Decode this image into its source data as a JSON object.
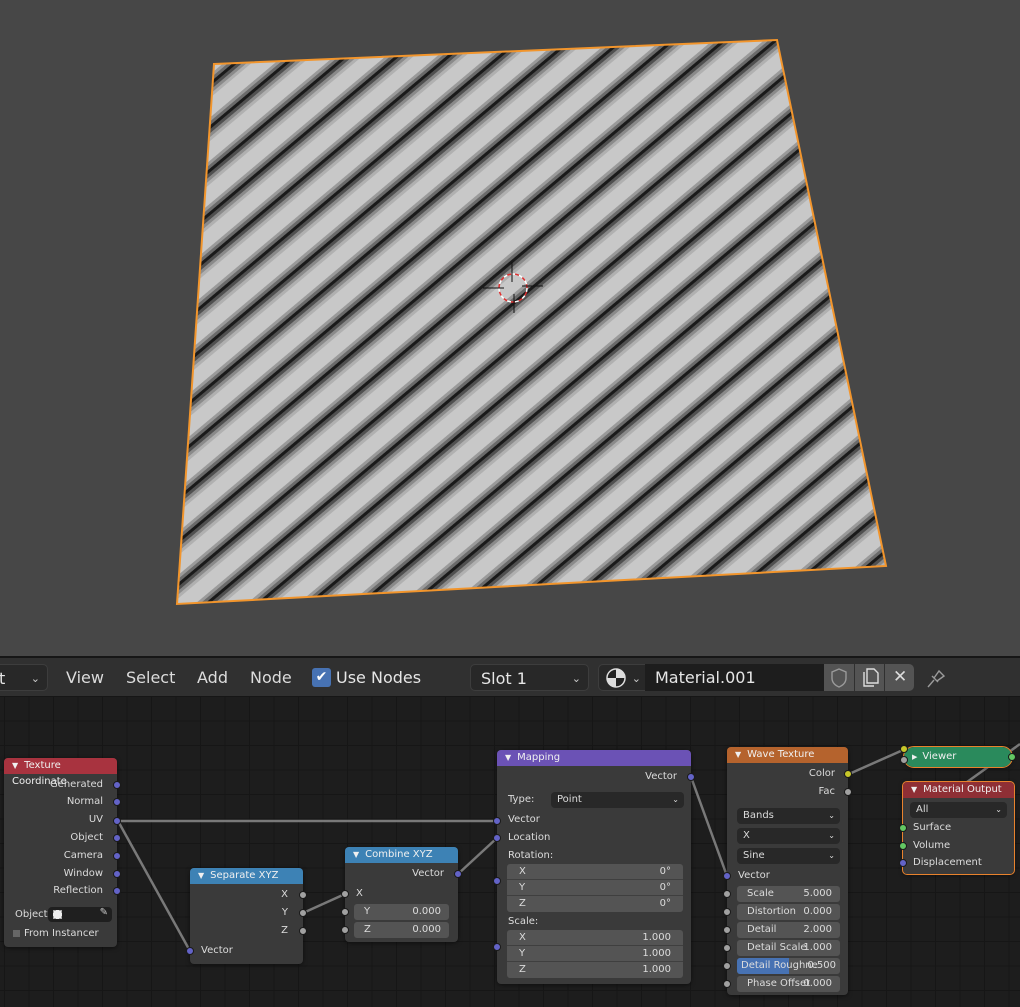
{
  "viewport": {
    "object": "Plane",
    "texture": "wave-stripes",
    "selection_outline_color": "#f2952c",
    "background_color": "#474747"
  },
  "header": {
    "editor_type_partial": "t",
    "menus": [
      "View",
      "Select",
      "Add",
      "Node"
    ],
    "use_nodes": {
      "label": "Use Nodes",
      "checked": true
    },
    "slot": "Slot 1",
    "material_name": "Material.001",
    "icons": [
      "material-sphere-icon",
      "fake-user-shield-icon",
      "duplicate-icon",
      "close-icon",
      "pin-icon"
    ]
  },
  "nodes": {
    "texture_coordinate": {
      "title": "Texture Coordinate",
      "color": "#a8333f",
      "outputs": [
        "Generated",
        "Normal",
        "UV",
        "Object",
        "Camera",
        "Window",
        "Reflection"
      ],
      "object_label": "Object:",
      "from_instancer": {
        "label": "From Instancer",
        "checked": false
      }
    },
    "separate_xyz": {
      "title": "Separate XYZ",
      "color": "#3d82b5",
      "outputs": [
        "X",
        "Y",
        "Z"
      ],
      "inputs": [
        "Vector"
      ]
    },
    "combine_xyz": {
      "title": "Combine XYZ",
      "color": "#3d82b5",
      "outputs": [
        "Vector"
      ],
      "inputs": [
        {
          "label": "X"
        },
        {
          "label": "Y",
          "value": "0.000"
        },
        {
          "label": "Z",
          "value": "0.000"
        }
      ]
    },
    "mapping": {
      "title": "Mapping",
      "color": "#6b52b5",
      "outputs": [
        "Vector"
      ],
      "type_label": "Type:",
      "type_value": "Point",
      "inputs": [
        "Vector",
        "Location"
      ],
      "rotation_label": "Rotation:",
      "rotation": [
        {
          "axis": "X",
          "value": "0°"
        },
        {
          "axis": "Y",
          "value": "0°"
        },
        {
          "axis": "Z",
          "value": "0°"
        }
      ],
      "scale_label": "Scale:",
      "scale": [
        {
          "axis": "X",
          "value": "1.000"
        },
        {
          "axis": "Y",
          "value": "1.000"
        },
        {
          "axis": "Z",
          "value": "1.000"
        }
      ]
    },
    "wave_texture": {
      "title": "Wave Texture",
      "color": "#b5632d",
      "outputs": [
        "Color",
        "Fac"
      ],
      "wave_type": "Bands",
      "direction": "X",
      "profile": "Sine",
      "vector_label": "Vector",
      "params": [
        {
          "label": "Scale",
          "value": "5.000"
        },
        {
          "label": "Distortion",
          "value": "0.000"
        },
        {
          "label": "Detail",
          "value": "2.000"
        },
        {
          "label": "Detail Scale",
          "value": "1.000"
        },
        {
          "label": "Detail Roughne",
          "value": "0.500",
          "fill": 0.5
        },
        {
          "label": "Phase Offset",
          "value": "0.000"
        }
      ]
    },
    "viewer": {
      "title": "Viewer",
      "color": "#2a8a5c"
    },
    "material_output": {
      "title": "Material Output",
      "color": "#8f2f35",
      "target": "All",
      "inputs": [
        "Surface",
        "Volume",
        "Displacement"
      ]
    }
  }
}
